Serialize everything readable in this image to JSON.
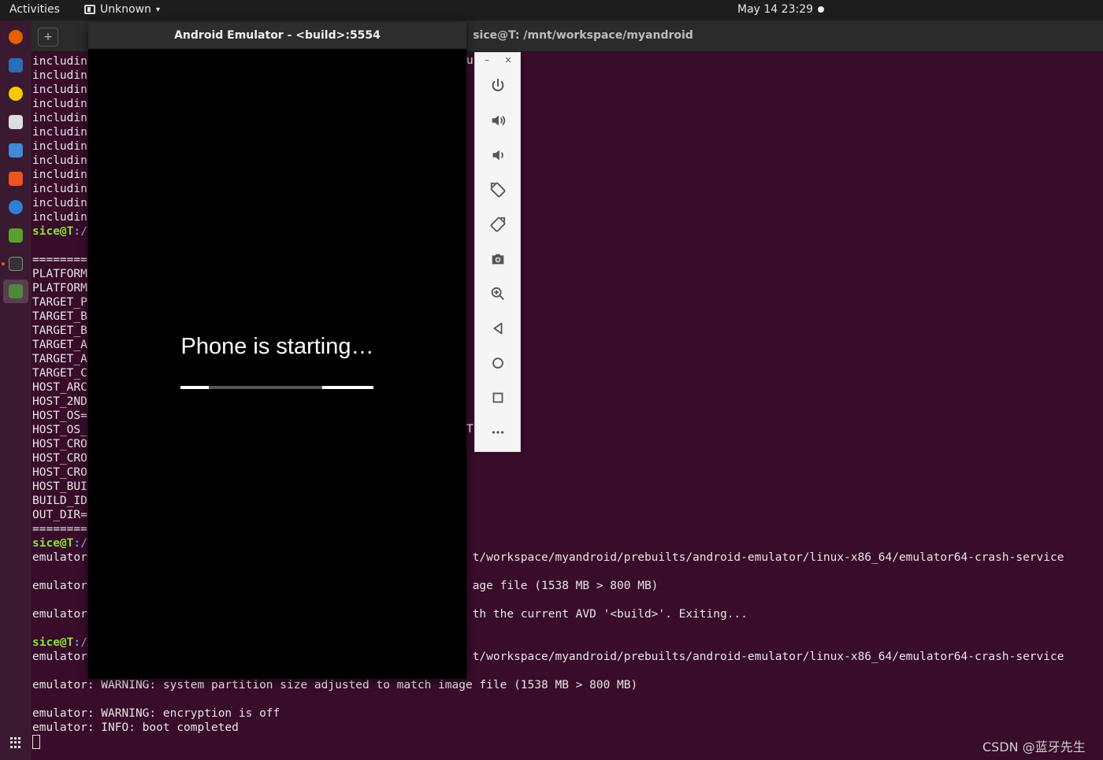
{
  "topbar": {
    "activities": "Activities",
    "app_name": "Unknown",
    "caret": "▾",
    "clock": "May 14  23:29"
  },
  "terminal": {
    "title": "sice@T: /mnt/workspace/myandroid",
    "new_tab": "+",
    "lines": [
      {
        "text": "includin"
      },
      {
        "text": "includin"
      },
      {
        "text": "includin"
      },
      {
        "text": "includin"
      },
      {
        "text": "includin"
      },
      {
        "text": "includin"
      },
      {
        "text": "includin"
      },
      {
        "text": "includin"
      },
      {
        "text": "includin"
      },
      {
        "text": "includin"
      },
      {
        "text": "includin"
      },
      {
        "text": "includin"
      },
      {
        "user": "sice@T",
        "path": ":/",
        "text": ""
      },
      {
        "text": ""
      },
      {
        "text": "========"
      },
      {
        "text": "PLATFORM"
      },
      {
        "text": "PLATFORM"
      },
      {
        "text": "TARGET_P"
      },
      {
        "text": "TARGET_B"
      },
      {
        "text": "TARGET_B"
      },
      {
        "text": "TARGET_A"
      },
      {
        "text": "TARGET_A"
      },
      {
        "text": "TARGET_C"
      },
      {
        "text": "HOST_ARC"
      },
      {
        "text": "HOST_2ND"
      },
      {
        "text": "HOST_OS="
      },
      {
        "text": "HOST_OS_"
      },
      {
        "text": "HOST_CRO"
      },
      {
        "text": "HOST_CRO"
      },
      {
        "text": "HOST_CRO"
      },
      {
        "text": "HOST_BUI"
      },
      {
        "text": "BUILD_ID"
      },
      {
        "text": "OUT_DIR="
      },
      {
        "text": "========"
      },
      {
        "user": "sice@T",
        "path": ":/",
        "text": ""
      },
      {
        "text": "emulator                                                        t/workspace/myandroid/prebuilts/android-emulator/linux-x86_64/emulator64-crash-service"
      },
      {
        "text": ""
      },
      {
        "text": "emulator                                                        age file (1538 MB > 800 MB)"
      },
      {
        "text": ""
      },
      {
        "text": "emulator                                                        th the current AVD '<build>'. Exiting..."
      },
      {
        "text": ""
      },
      {
        "user": "sice@T",
        "path": ":/",
        "text": ""
      },
      {
        "text": "emulator                                                        t/workspace/myandroid/prebuilts/android-emulator/linux-x86_64/emulator64-crash-service"
      },
      {
        "text": ""
      },
      {
        "text": "emulator: WARNING: system partition size adjusted to match image file (1538 MB > 800 MB)"
      },
      {
        "text": ""
      },
      {
        "text": "emulator: WARNING: encryption is off"
      },
      {
        "text": "emulator: INFO: boot completed"
      }
    ],
    "right_fragments": [
      {
        "row": 0,
        "text": "u"
      },
      {
        "row": 26,
        "text": "T:"
      }
    ]
  },
  "emulator": {
    "title": "Android Emulator - <build>:5554",
    "boot_message": "Phone is starting…",
    "progress": {
      "seg1_start": 0.0,
      "seg1_end": 0.147,
      "seg2_start": 0.735,
      "seg2_end": 1.0
    }
  },
  "toolbar": {
    "minimize": "–",
    "close": "×",
    "buttons": [
      "power",
      "volume-up",
      "volume-down",
      "rotate-left",
      "rotate-right",
      "screenshot",
      "zoom",
      "back",
      "home",
      "overview",
      "more"
    ]
  },
  "watermark": "CSDN @蓝牙先生"
}
